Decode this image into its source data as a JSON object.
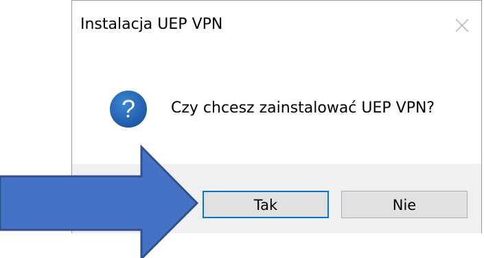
{
  "dialog": {
    "title": "Instalacja UEP VPN",
    "message": "Czy chcesz zainstalować UEP VPN?",
    "icon": "question-icon",
    "buttons": {
      "yes_label": "Tak",
      "no_label": "Nie"
    }
  },
  "overlay": {
    "arrow_color": "#4472c4",
    "arrow_border": "#2f528f",
    "icon": "arrow-right-icon"
  },
  "colors": {
    "question_icon": "#1e5fae",
    "focus_border": "#0078d7",
    "footer_bg": "#f0f0f0"
  }
}
